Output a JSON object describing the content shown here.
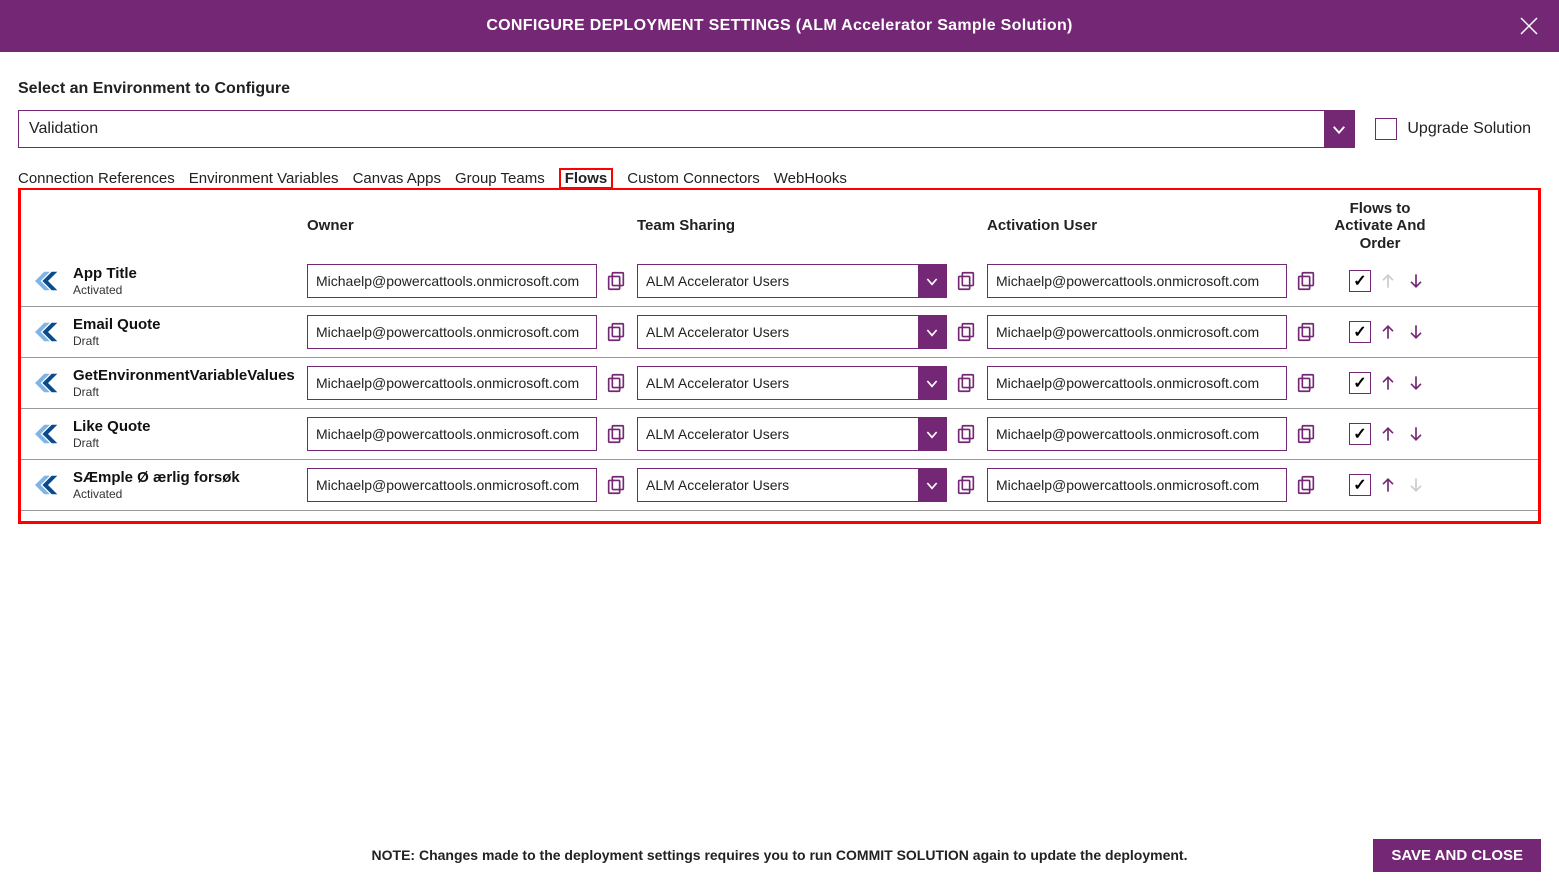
{
  "titlebar": {
    "title": "CONFIGURE DEPLOYMENT SETTINGS (ALM Accelerator Sample Solution)"
  },
  "env": {
    "label": "Select an Environment to Configure",
    "value": "Validation",
    "upgrade_label": "Upgrade Solution",
    "upgrade_checked": false
  },
  "tabs": [
    {
      "label": "Connection References",
      "active": false
    },
    {
      "label": "Environment Variables",
      "active": false
    },
    {
      "label": "Canvas Apps",
      "active": false
    },
    {
      "label": "Group Teams",
      "active": false
    },
    {
      "label": "Flows",
      "active": true
    },
    {
      "label": "Custom Connectors",
      "active": false
    },
    {
      "label": "WebHooks",
      "active": false
    }
  ],
  "headers": {
    "owner": "Owner",
    "team": "Team Sharing",
    "activation": "Activation User",
    "activate": "Flows to Activate And Order"
  },
  "flows": [
    {
      "title": "App Title",
      "status": "Activated",
      "owner": "Michaelp@powercattools.onmicrosoft.com",
      "team": "ALM Accelerator Users",
      "activation": "Michaelp@powercattools.onmicrosoft.com",
      "checked": true,
      "up": false,
      "down": true
    },
    {
      "title": "Email Quote",
      "status": "Draft",
      "owner": "Michaelp@powercattools.onmicrosoft.com",
      "team": "ALM Accelerator Users",
      "activation": "Michaelp@powercattools.onmicrosoft.com",
      "checked": true,
      "up": true,
      "down": true
    },
    {
      "title": "GetEnvironmentVariableValues",
      "status": "Draft",
      "owner": "Michaelp@powercattools.onmicrosoft.com",
      "team": "ALM Accelerator Users",
      "activation": "Michaelp@powercattools.onmicrosoft.com",
      "checked": true,
      "up": true,
      "down": true
    },
    {
      "title": "Like Quote",
      "status": "Draft",
      "owner": "Michaelp@powercattools.onmicrosoft.com",
      "team": "ALM Accelerator Users",
      "activation": "Michaelp@powercattools.onmicrosoft.com",
      "checked": true,
      "up": true,
      "down": true
    },
    {
      "title": "SÆmple Ø ærlig forsøk",
      "status": "Activated",
      "owner": "Michaelp@powercattools.onmicrosoft.com",
      "team": "ALM Accelerator Users",
      "activation": "Michaelp@powercattools.onmicrosoft.com",
      "checked": true,
      "up": true,
      "down": false
    }
  ],
  "footer": {
    "note": "NOTE: Changes made to the deployment settings requires you to run COMMIT SOLUTION again to update the deployment.",
    "save": "SAVE AND CLOSE"
  }
}
